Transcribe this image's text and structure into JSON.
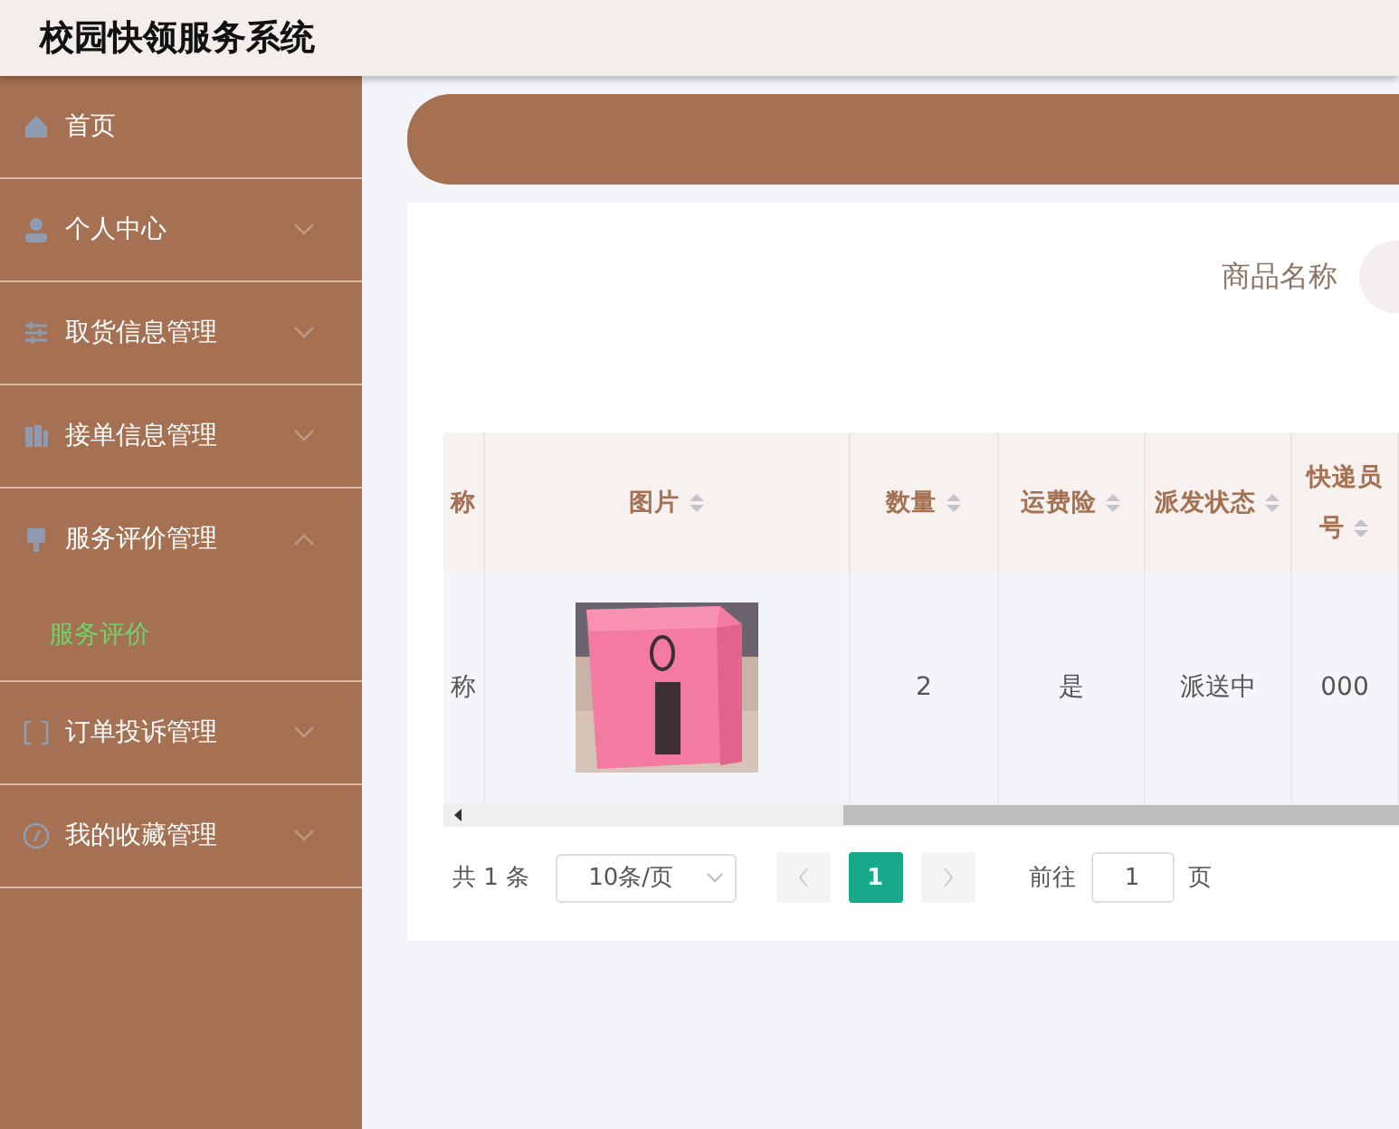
{
  "header": {
    "title": "校园快领服务系统"
  },
  "sidebar": {
    "items": [
      {
        "kind": "link",
        "label": "首页"
      },
      {
        "kind": "submenu",
        "label": "个人中心",
        "expanded": false
      },
      {
        "kind": "submenu",
        "label": "取货信息管理",
        "expanded": false
      },
      {
        "kind": "submenu",
        "label": "接单信息管理",
        "expanded": false
      },
      {
        "kind": "submenu",
        "label": "服务评价管理",
        "expanded": true,
        "children": [
          {
            "label": "服务评价",
            "selected": true
          }
        ]
      },
      {
        "kind": "submenu",
        "label": "订单投诉管理",
        "expanded": false
      },
      {
        "kind": "submenu",
        "label": "我的收藏管理",
        "expanded": false
      }
    ]
  },
  "search": {
    "label": "商品名称"
  },
  "table": {
    "columns": [
      {
        "lines": [
          "称"
        ],
        "sortable": false
      },
      {
        "lines": [
          "图片"
        ],
        "sortable": true
      },
      {
        "lines": [
          "数量"
        ],
        "sortable": true
      },
      {
        "lines": [
          "运费险"
        ],
        "sortable": true
      },
      {
        "lines": [
          "派发状态"
        ],
        "sortable": true
      },
      {
        "lines": [
          "快递员",
          "号"
        ],
        "sortable": true
      }
    ],
    "rows": [
      {
        "cells": [
          {
            "kind": "text",
            "text": "称"
          },
          {
            "kind": "picture"
          },
          {
            "kind": "text",
            "text": "2"
          },
          {
            "kind": "text",
            "text": "是"
          },
          {
            "kind": "text",
            "text": "派送中"
          },
          {
            "kind": "text",
            "text": "000"
          }
        ]
      }
    ]
  },
  "pagination": {
    "total": "共 1 条",
    "page_size": "10条/页",
    "pages": [
      {
        "label": "1",
        "selected": true
      }
    ],
    "goto_label": "前往",
    "goto_value": "1",
    "goto_suffix": "页"
  }
}
